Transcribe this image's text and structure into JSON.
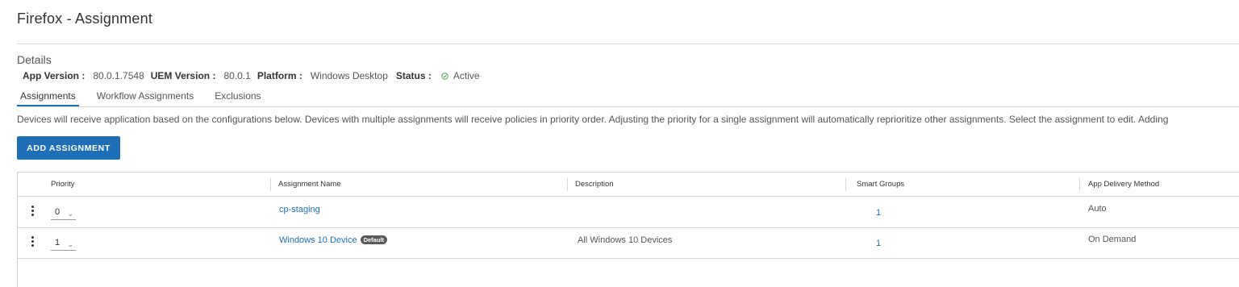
{
  "window": {
    "title": "Firefox - Assignment"
  },
  "details": {
    "heading": "Details",
    "app_version_label": "App Version :",
    "app_version": "80.0.1.7548",
    "uem_version_label": "UEM Version :",
    "uem_version": "80.0.1",
    "platform_label": "Platform :",
    "platform": "Windows Desktop",
    "status_label": "Status :",
    "status": "Active",
    "status_color": "#3a9b3a"
  },
  "tabs": [
    {
      "label": "Assignments",
      "active": true
    },
    {
      "label": "Workflow Assignments",
      "active": false
    },
    {
      "label": "Exclusions",
      "active": false
    }
  ],
  "info_text": "Devices will receive application based on the configurations below. Devices with multiple assignments will receive policies in priority order. Adjusting the priority for a single assignment will automatically reprioritize other assignments. Select the assignment to edit. Adding",
  "add_button_label": "ADD ASSIGNMENT",
  "accent_color": "#1e6fb5",
  "table": {
    "columns": [
      "Priority",
      "Assignment Name",
      "Description",
      "Smart Groups",
      "App Delivery Method"
    ],
    "rows": [
      {
        "priority": "0",
        "name": "cp-staging",
        "badge": "",
        "description": "",
        "smart_groups": "1",
        "delivery": "Auto"
      },
      {
        "priority": "1",
        "name": "Windows 10 Device",
        "badge": "Default",
        "description": "All Windows 10 Devices",
        "smart_groups": "1",
        "delivery": "On Demand"
      }
    ]
  },
  "icons": {
    "row_menu": "vertical-ellipsis-icon",
    "dropdown": "chevron-down-icon",
    "status": "check-circle-icon"
  }
}
